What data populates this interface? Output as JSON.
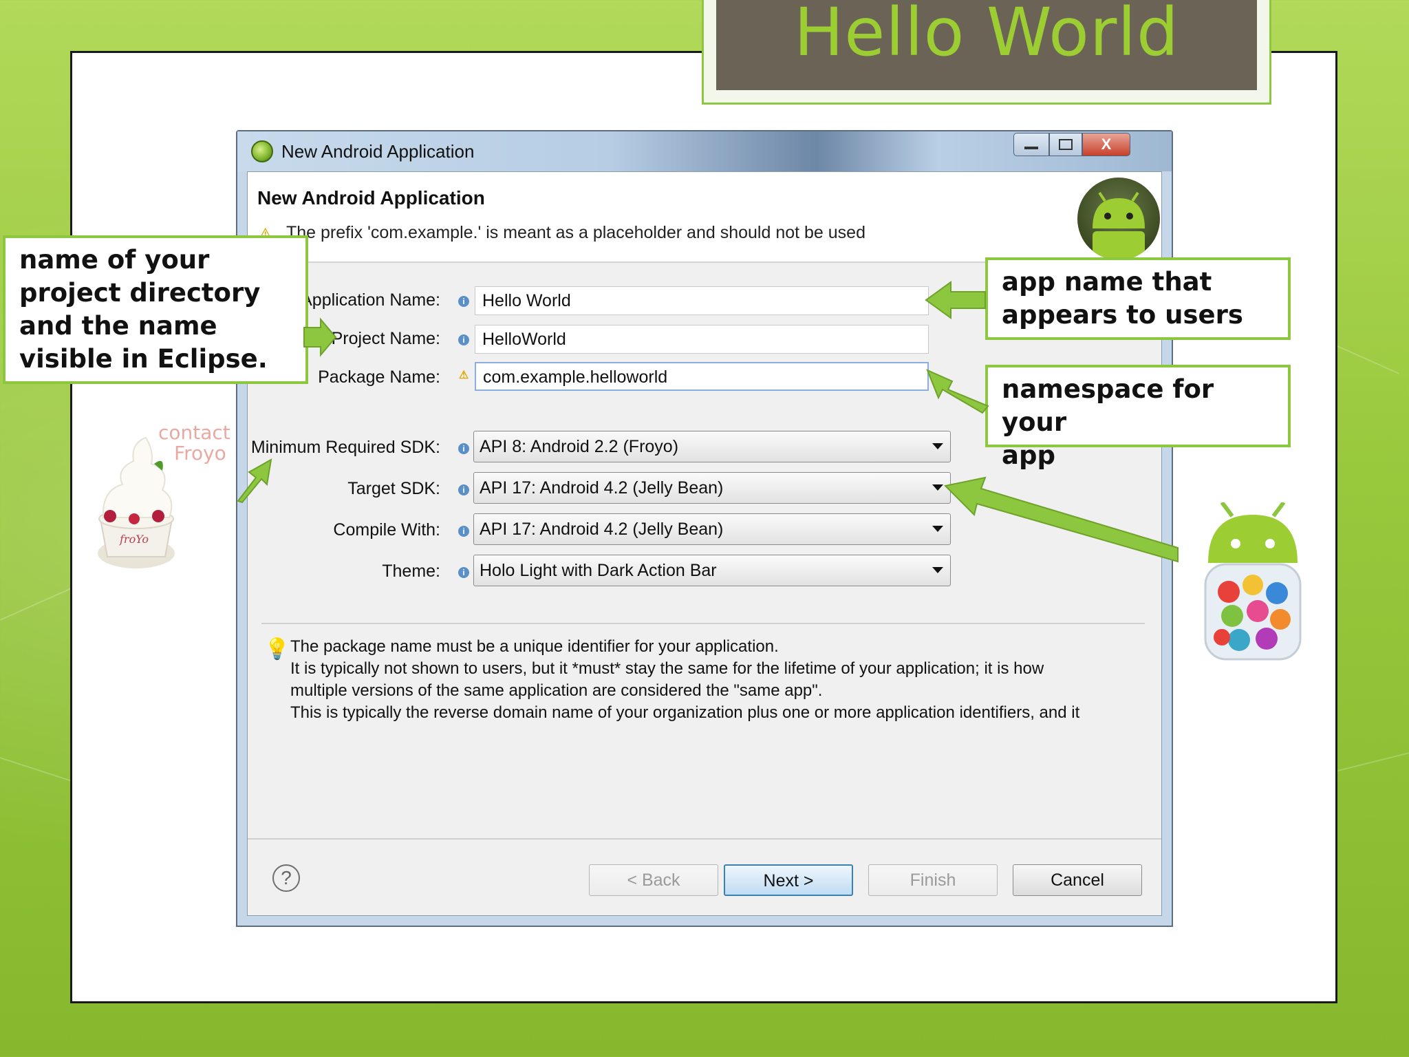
{
  "slide": {
    "title": "Hello World"
  },
  "dialog": {
    "window_title": "New Android Application",
    "heading": "New Android Application",
    "warning": "The prefix 'com.example.' is meant as a placeholder and should not be used",
    "fields": {
      "application_name_label": "Application Name:",
      "application_name_value": "Hello World",
      "project_name_label": "Project Name:",
      "project_name_value": "HelloWorld",
      "package_name_label": "Package Name:",
      "package_name_value": "com.example.helloworld"
    },
    "selects": {
      "min_sdk_label": "Minimum Required SDK:",
      "min_sdk_value": "API 8: Android 2.2 (Froyo)",
      "target_sdk_label": "Target SDK:",
      "target_sdk_value": "API 17: Android 4.2 (Jelly Bean)",
      "compile_with_label": "Compile With:",
      "compile_with_value": "API 17: Android 4.2 (Jelly Bean)",
      "theme_label": "Theme:",
      "theme_value": "Holo Light with Dark Action Bar"
    },
    "hint_lines": [
      "The package name must be a unique identifier for your application.",
      "It is typically not shown to users, but it *must* stay the same for the lifetime of your application; it is how",
      "multiple versions of the same application are considered the \"same app\".",
      "This is typically the reverse domain name of your organization plus one or more application identifiers, and it"
    ],
    "buttons": {
      "back": "< Back",
      "next": "Next >",
      "finish": "Finish",
      "cancel": "Cancel"
    },
    "window_controls": {
      "close": "X"
    }
  },
  "callouts": {
    "project_directory": [
      "name of your",
      "project directory",
      "and the name",
      "visible in Eclipse."
    ],
    "app_name": [
      "app name that",
      "appears to users"
    ],
    "namespace": [
      "namespace for your",
      "app"
    ]
  },
  "froyo_image_text": {
    "line1": "contact",
    "line2": "Froyo",
    "cup": "froYo"
  },
  "colors": {
    "accent_green": "#8dc63f",
    "title_bg": "#6b6355",
    "title_text": "#9ccd32"
  },
  "icons": [
    "android-app-icon",
    "warning-icon",
    "info-icon",
    "lightbulb-icon",
    "help-icon",
    "android-robot-icon",
    "jelly-bean-icon",
    "froyo-icon"
  ]
}
